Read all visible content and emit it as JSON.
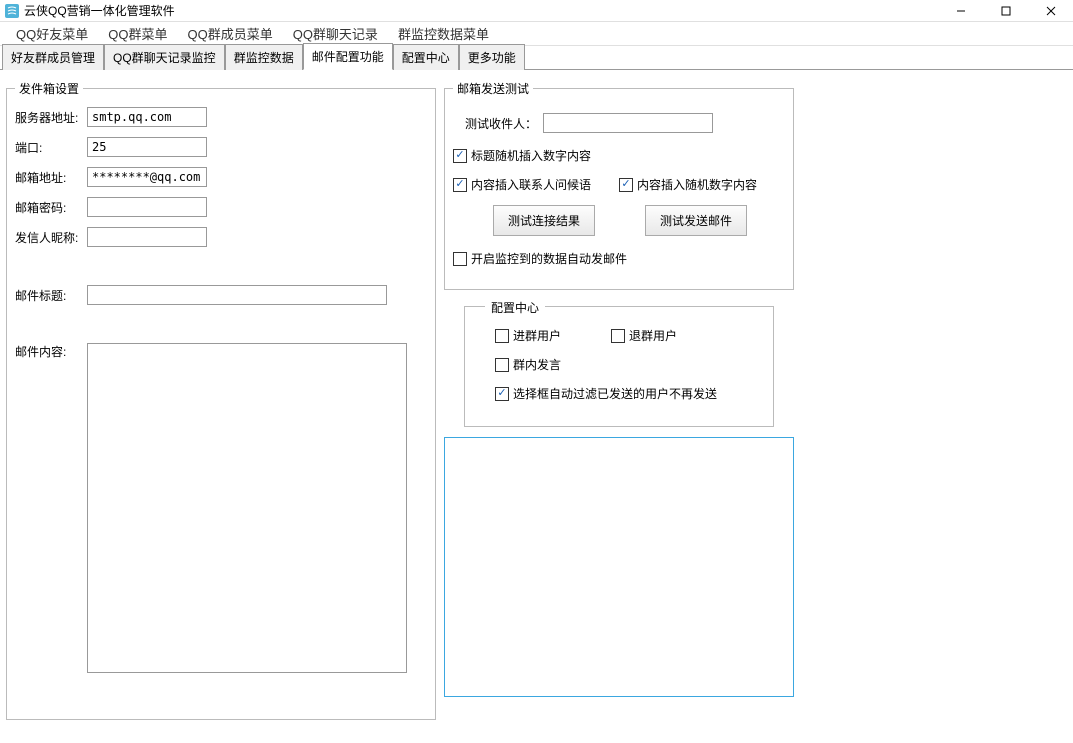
{
  "window": {
    "title": "云侠QQ营销一体化管理软件"
  },
  "menubar": {
    "items": [
      "QQ好友菜单",
      "QQ群菜单",
      "QQ群成员菜单",
      "QQ群聊天记录",
      "群监控数据菜单"
    ]
  },
  "tabs": {
    "items": [
      "好友群成员管理",
      "QQ群聊天记录监控",
      "群监控数据",
      "邮件配置功能",
      "配置中心",
      "更多功能"
    ],
    "active_index": 3
  },
  "sendbox": {
    "legend": "发件箱设置",
    "server_label": "服务器地址:",
    "server_value": "smtp.qq.com",
    "port_label": "端口:",
    "port_value": "25",
    "email_label": "邮箱地址:",
    "email_value": "********@qq.com",
    "password_label": "邮箱密码:",
    "password_value": "",
    "nickname_label": "发信人昵称:",
    "nickname_value": "",
    "subject_label": "邮件标题:",
    "subject_value": "",
    "content_label": "邮件内容:",
    "content_value": ""
  },
  "sendtest": {
    "legend": "邮箱发送测试",
    "recipient_label": "测试收件人：",
    "recipient_value": "",
    "check_random_number_title": "标题随机插入数字内容",
    "check_greeting": "内容插入联系人问候语",
    "check_random_number_content": "内容插入随机数字内容",
    "btn_test_connection": "测试连接结果",
    "btn_test_send": "测试发送邮件",
    "check_auto_send": "开启监控到的数据自动发邮件"
  },
  "config_center": {
    "legend": "配置中心",
    "check_join_group": "进群用户",
    "check_leave_group": "退群用户",
    "check_group_speak": "群内发言",
    "check_filter_sent": "选择框自动过滤已发送的用户不再发送"
  }
}
